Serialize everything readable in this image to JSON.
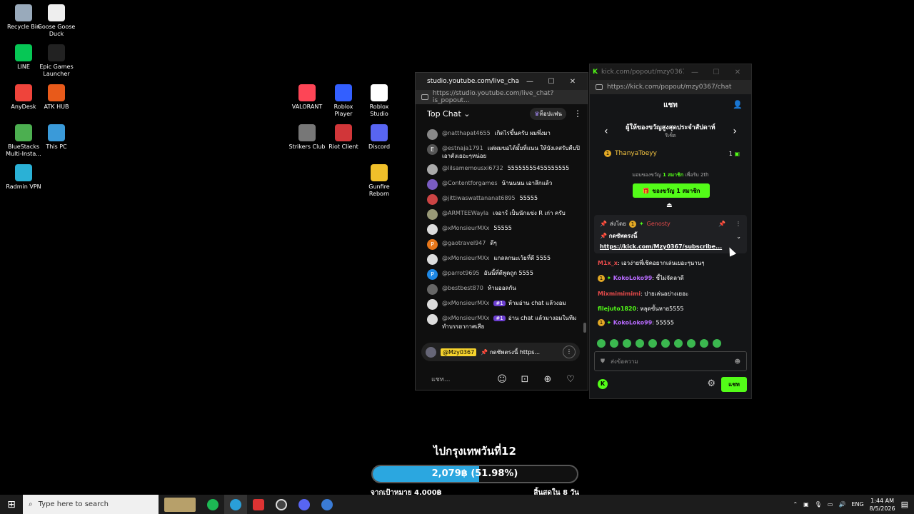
{
  "desktop": {
    "icons": [
      {
        "label": "Recycle Bin",
        "icon": "recycle-bin-icon",
        "color": "#9ab"
      },
      {
        "label": "Goose Goose Duck",
        "icon": "goose-icon",
        "color": "#eee"
      },
      {
        "label": "LINE",
        "icon": "line-icon",
        "color": "#06c755"
      },
      {
        "label": "Epic Games Launcher",
        "icon": "epic-icon",
        "color": "#222"
      },
      {
        "label": "AnyDesk",
        "icon": "anydesk-icon",
        "color": "#ef443b"
      },
      {
        "label": "ATK HUB",
        "icon": "atk-icon",
        "color": "#e85a1a"
      },
      {
        "label": "BlueStacks Multi-Insta...",
        "icon": "bluestacks-icon",
        "color": "#4caf50"
      },
      {
        "label": "This PC",
        "icon": "pc-icon",
        "color": "#3a9ad9"
      },
      {
        "label": "Radmin VPN",
        "icon": "radmin-icon",
        "color": "#2ab1d6"
      },
      {
        "label": "VALORANT",
        "icon": "valorant-icon",
        "color": "#fd4556"
      },
      {
        "label": "Roblox Player",
        "icon": "roblox-icon",
        "color": "#335fff"
      },
      {
        "label": "Roblox Studio",
        "icon": "roblox-studio-icon",
        "color": "#fff"
      },
      {
        "label": "Strikers Club",
        "icon": "strikers-icon",
        "color": "#777"
      },
      {
        "label": "Riot Client",
        "icon": "riot-icon",
        "color": "#d13639"
      },
      {
        "label": "Discord",
        "icon": "discord-icon",
        "color": "#5865f2"
      },
      {
        "label": "Gunfire Reborn",
        "icon": "gunfire-icon",
        "color": "#f0c02a"
      }
    ]
  },
  "youtube": {
    "title": "studio.youtube.com/live_chat?i...",
    "url": "https://studio.youtube.com/live_chat?is_popout...",
    "header": "Top Chat",
    "fan_button": "ท็อปแฟน",
    "messages": [
      {
        "author": "@natthapat4655",
        "text": "เกิดไรขึ้นครับ ผมพึ่งมา",
        "badge": "",
        "avatar_color": "#888"
      },
      {
        "author": "@estnaja1791",
        "text": "แต่ผมขอได้มั้ยที่แนน ให้บังเลสรับคืบปิเอาตังเยอะๆหน่อย",
        "badge": "",
        "avatar_color": "#555",
        "avatar_letter": "E"
      },
      {
        "author": "@lilsamemousxi6732",
        "text": "55555555455555555",
        "badge": "",
        "avatar_color": "#aaa"
      },
      {
        "author": "@Contentforgames",
        "text": "น้านนนน เอาลึกแล้ว",
        "badge": "",
        "avatar_color": "#7a5cc2"
      },
      {
        "author": "@jittiwaswattananat6895",
        "text": "55555",
        "badge": "",
        "avatar_color": "#c44"
      },
      {
        "author": "@ARMTEEWayla",
        "text": "เจอาร์ เป็นนักแข่ง R เก่า ครับ",
        "badge": "",
        "avatar_color": "#997"
      },
      {
        "author": "@xMonsieurMXx",
        "text": "55555",
        "badge": "",
        "avatar_color": "#ddd"
      },
      {
        "author": "@gaotravel947",
        "text": "ดีๆ",
        "badge": "",
        "avatar_color": "#e8771a",
        "avatar_letter": "P"
      },
      {
        "author": "@xMonsieurMXx",
        "text": "แกลลกนะเว้ยที่ดี 5555",
        "badge": "",
        "avatar_color": "#ddd"
      },
      {
        "author": "@parrot9695",
        "text": "อันนี้ที่ดีพูดถูก 5555",
        "badge": "",
        "avatar_color": "#1e88e5",
        "avatar_letter": "P"
      },
      {
        "author": "@bestbest870",
        "text": "ห้ามออลกัน",
        "badge": "",
        "avatar_color": "#666"
      },
      {
        "author": "@xMonsieurMXx",
        "text": "ห้ามอ่าน chat แล้วงอม",
        "badge": "#1",
        "avatar_color": "#ddd"
      },
      {
        "author": "@xMonsieurMXx",
        "text": "อ่าน chat แล้วมางอมในทีมทำบรรยากาศเสีย",
        "badge": "#1",
        "avatar_color": "#ddd"
      }
    ],
    "pinned": {
      "tag": "@Mzy0367",
      "text": "📌 กดซัพตรงนี้ https..."
    },
    "input_placeholder": "แชท..."
  },
  "kick": {
    "title": "kick.com/popout/mzy0367...",
    "url": "https://kick.com/popout/mzy0367/chat",
    "header": "แชท",
    "gifter_title": "ผู้ให้ของขวัญสูงสุดประจำสัปดาห์",
    "gifter_sub": "รีเซ็ต",
    "top_gifter": "ThanyaToeyy",
    "top_count": "1",
    "gift_line_pre": "มอบของขวัญ",
    "gift_line_bold": "1 สมาชิก",
    "gift_line_post": "เพื่อรับ 2th",
    "gift_button": "ของขวัญ 1 สมาชิก",
    "pinned_by": "ส่งโดย",
    "pinned_name": "Genosty",
    "pinned_text": "📌 กดซัพตรงนี้",
    "pinned_link": "https://kick.com/Mzy0367/subscribe...",
    "messages": [
      {
        "user": "M1x_x",
        "text": ": เอวง่ายพี่เชิคอยากเล่นเยอะๆนานๆ",
        "color": "#e64a4a",
        "badges": false
      },
      {
        "user": "KokoLoko99",
        "text": ": ชี้ไม่จัดลาดี",
        "color": "#b86bff",
        "badges": true
      },
      {
        "user": "Mixmimimimi",
        "text": ": ปายเล่นอย่างเยอะ",
        "color": "#e64a4a",
        "badges": false
      },
      {
        "user": "filejuto1820",
        "text": ": หลุดขั้นหาย5555",
        "color": "#53fc18",
        "badges": false
      },
      {
        "user": "KokoLoko99",
        "text": ": 55555",
        "color": "#b86bff",
        "badges": true
      }
    ],
    "send_placeholder": "ส่งข้อความ",
    "chat_button": "แชท",
    "accent": "#53fc18"
  },
  "goal": {
    "title": "ไปกรุงเทพวันที่12",
    "amount_text": "2,079฿ (51.98%)",
    "progress": 0.5198,
    "target_text": "จากเป้าหมาย 4,000฿",
    "ends_text": "สิ้นสุดใน 8 วัน"
  },
  "taskbar": {
    "search_placeholder": "Type here to search",
    "lang": "ENG",
    "time": "1:44 AM",
    "date": "8/5/2026"
  }
}
